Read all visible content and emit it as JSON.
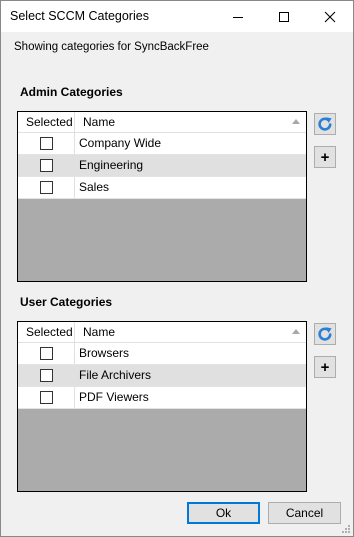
{
  "window": {
    "title": "Select SCCM Categories",
    "minimize_icon": "minimize-icon",
    "maximize_icon": "maximize-icon",
    "close_icon": "close-icon"
  },
  "subtitle": "Showing categories for SyncBackFree",
  "admin": {
    "label": "Admin Categories",
    "columns": {
      "selected": "Selected",
      "name": "Name"
    },
    "rows": [
      {
        "name": "Company Wide",
        "checked": false,
        "highlighted": false
      },
      {
        "name": "Engineering",
        "checked": false,
        "highlighted": true
      },
      {
        "name": "Sales",
        "checked": false,
        "highlighted": false
      }
    ],
    "refresh_icon": "refresh-icon",
    "add_label": "+"
  },
  "user": {
    "label": "User Categories",
    "columns": {
      "selected": "Selected",
      "name": "Name"
    },
    "rows": [
      {
        "name": "Browsers",
        "checked": false,
        "highlighted": false
      },
      {
        "name": "File Archivers",
        "checked": false,
        "highlighted": true
      },
      {
        "name": "PDF Viewers",
        "checked": false,
        "highlighted": false
      }
    ],
    "refresh_icon": "refresh-icon",
    "add_label": "+"
  },
  "buttons": {
    "ok": "Ok",
    "cancel": "Cancel"
  },
  "colors": {
    "accent": "#0078d7",
    "refresh_blue": "#2b7fd6",
    "grid_empty": "#ababab",
    "row_highlight": "#e0e0e0"
  }
}
